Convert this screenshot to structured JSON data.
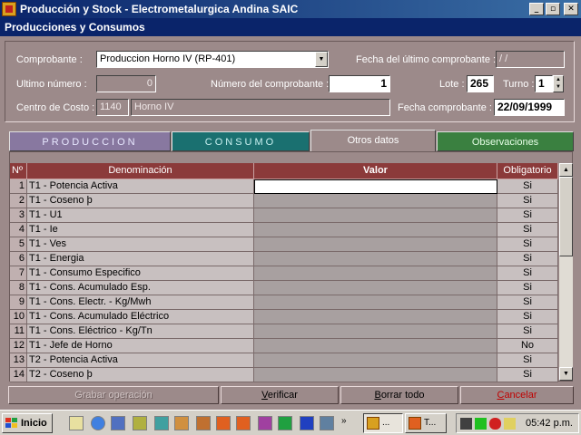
{
  "window": {
    "title": "Producción y Stock - Electrometalurgica Andina SAIC",
    "min_glyph": "_",
    "max_glyph": "▫",
    "close_glyph": "✕"
  },
  "form": {
    "title": "Producciones y Consumos",
    "comprobante_label": "Comprobante :",
    "comprobante_value": "Produccion Horno IV (RP-401)",
    "fecha_ultimo_label": "Fecha del último comprobante :",
    "fecha_ultimo_value": "/  /",
    "ultimo_numero_label": "Ultimo número :",
    "ultimo_numero_value": "0",
    "numero_comprobante_label": "Número del comprobante :",
    "numero_comprobante_value": "1",
    "lote_label": "Lote :",
    "lote_value": "265",
    "turno_label": "Turno :",
    "turno_value": "1",
    "centro_costo_label": "Centro de Costo :",
    "centro_costo_code": "1140",
    "centro_costo_name": "Horno  IV",
    "fecha_comprobante_label": "Fecha comprobante :",
    "fecha_comprobante_value": "22/09/1999"
  },
  "tabs": [
    {
      "label": "PRODUCCION"
    },
    {
      "label": "CONSUMO"
    },
    {
      "label": "Otros datos"
    },
    {
      "label": "Observaciones"
    }
  ],
  "grid": {
    "headers": {
      "num": "Nº",
      "denominacion": "Denominación",
      "valor": "Valor",
      "obligatorio": "Obligatorio"
    },
    "rows": [
      {
        "num": "1",
        "denominacion": "T1 - Potencia Activa",
        "valor": "",
        "obligatorio": "Si"
      },
      {
        "num": "2",
        "denominacion": "T1 - Coseno þ",
        "valor": "",
        "obligatorio": "Si"
      },
      {
        "num": "3",
        "denominacion": "T1 - U1",
        "valor": "",
        "obligatorio": "Si"
      },
      {
        "num": "4",
        "denominacion": "T1 - Ie",
        "valor": "",
        "obligatorio": "Si"
      },
      {
        "num": "5",
        "denominacion": "T1 - Ves",
        "valor": "",
        "obligatorio": "Si"
      },
      {
        "num": "6",
        "denominacion": "T1 - Energia",
        "valor": "",
        "obligatorio": "Si"
      },
      {
        "num": "7",
        "denominacion": "T1 - Consumo Especifico",
        "valor": "",
        "obligatorio": "Si"
      },
      {
        "num": "8",
        "denominacion": "T1 - Cons. Acumulado Esp.",
        "valor": "",
        "obligatorio": "Si"
      },
      {
        "num": "9",
        "denominacion": "T1 - Cons. Electr. - Kg/Mwh",
        "valor": "",
        "obligatorio": "Si"
      },
      {
        "num": "10",
        "denominacion": "T1 - Cons. Acumulado Eléctrico",
        "valor": "",
        "obligatorio": "Si"
      },
      {
        "num": "11",
        "denominacion": "T1 - Cons. Eléctrico - Kg/Tn",
        "valor": "",
        "obligatorio": "Si"
      },
      {
        "num": "12",
        "denominacion": "T1 - Jefe de Horno",
        "valor": "",
        "obligatorio": "No"
      },
      {
        "num": "13",
        "denominacion": "T2 - Potencia Activa",
        "valor": "",
        "obligatorio": "Si"
      },
      {
        "num": "14",
        "denominacion": "T2 - Coseno þ",
        "valor": "",
        "obligatorio": "Si"
      }
    ]
  },
  "actions": {
    "grabar": "Grabar operación",
    "verificar": "Verificar",
    "borrar": "Borrar todo",
    "cancelar": "Cancelar"
  },
  "taskbar": {
    "start_label": "Inicio",
    "task1_label": "...",
    "task2_label": "T...",
    "clock": "05:42 p.m."
  },
  "colors": {
    "form_bg": "#9c8a8a",
    "grid_header": "#8b3a3a",
    "titlebar": "#0a246a",
    "cancel_text": "#c00000"
  }
}
